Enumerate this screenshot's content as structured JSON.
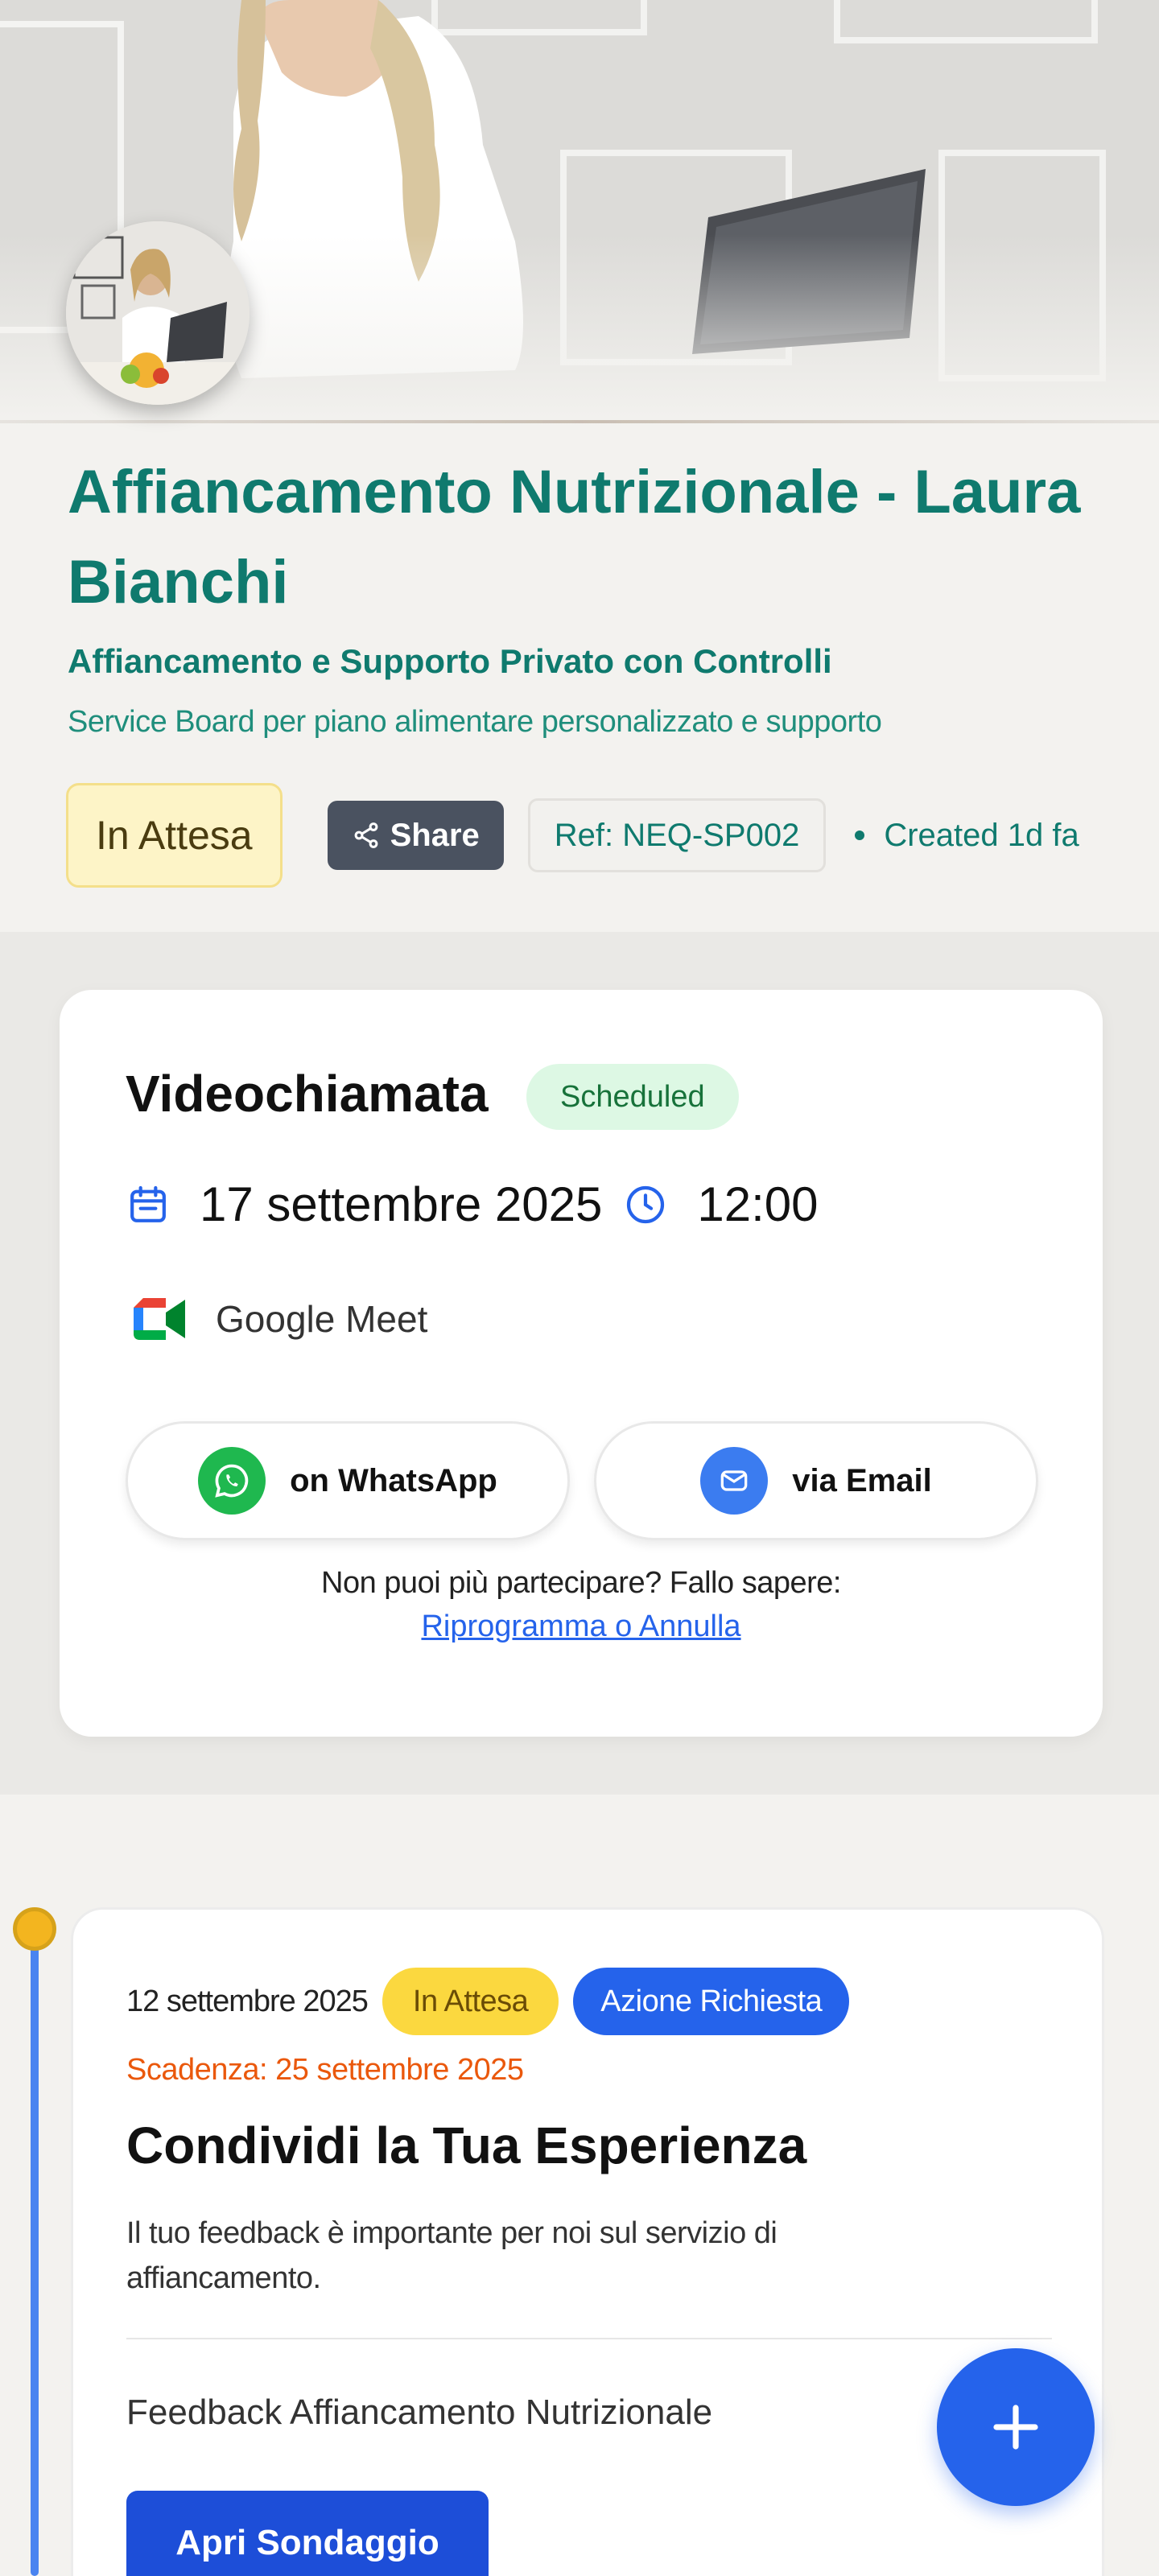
{
  "header": {
    "title": "Affiancamento Nutrizionale - Laura Bianchi",
    "subtitle": "Affiancamento e Supporto Privato con Controlli",
    "description": "Service Board per piano alimentare personalizzato e supporto",
    "status": "In Attesa",
    "share_label": "Share",
    "reference": "Ref: NEQ-SP002",
    "created": "Created 1d fa"
  },
  "appointment": {
    "type": "Videochiamata",
    "status": "Scheduled",
    "date": "17 settembre 2025",
    "time": "12:00",
    "platform": "Google Meet",
    "whatsapp_label": "on WhatsApp",
    "email_label": "via Email",
    "cant_attend": "Non puoi più partecipare? Fallo sapere:",
    "reschedule_link": "Riprogramma o Annulla"
  },
  "timeline": {
    "items": [
      {
        "date": "12 settembre 2025",
        "status": "In Attesa",
        "action": "Azione Richiesta",
        "deadline": "Scadenza: 25 settembre 2025",
        "title": "Condividi la Tua Esperienza",
        "description": "Il tuo feedback è importante per noi sul servizio di affiancamento.",
        "survey_name": "Feedback Affiancamento Nutrizionale",
        "button_label": "Apri Sondaggio"
      }
    ]
  },
  "icons": {
    "share": "share-icon",
    "calendar": "calendar-icon",
    "clock": "clock-icon",
    "google_meet": "google-meet-icon",
    "whatsapp": "whatsapp-icon",
    "email": "mail-icon",
    "fab": "plus-icon"
  },
  "colors": {
    "brand": "#0f7a6e",
    "accent": "#2563eb",
    "waiting": "#fbd83f",
    "deadline": "#ea580c",
    "scheduled": "#ddf8e4"
  }
}
